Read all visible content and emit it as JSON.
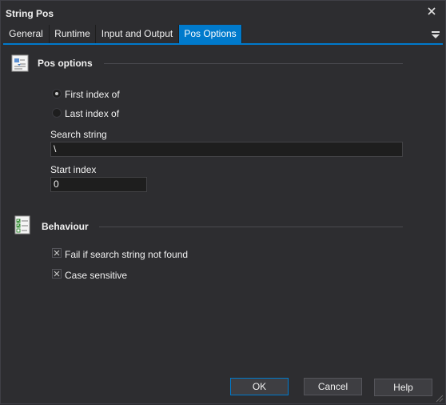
{
  "window": {
    "title": "String Pos"
  },
  "tabs": [
    {
      "label": "General",
      "active": false
    },
    {
      "label": "Runtime",
      "active": false
    },
    {
      "label": "Input and Output",
      "active": false
    },
    {
      "label": "Pos Options",
      "active": true
    }
  ],
  "pos_options": {
    "title": "Pos options",
    "radio_first": {
      "label": "First index of",
      "checked": true
    },
    "radio_last": {
      "label": "Last index of",
      "checked": false
    },
    "search_label": "Search string",
    "search_value": "\\",
    "start_label": "Start index",
    "start_value": "0"
  },
  "behaviour": {
    "title": "Behaviour",
    "fail_if_not_found": {
      "label": "Fail if search string not found",
      "checked": true
    },
    "case_sensitive": {
      "label": "Case sensitive",
      "checked": true
    }
  },
  "buttons": {
    "ok": "OK",
    "cancel": "Cancel",
    "help": "Help"
  },
  "colors": {
    "background": "#2d2d30",
    "accent": "#007acc",
    "input_bg": "#1e1e1e"
  }
}
